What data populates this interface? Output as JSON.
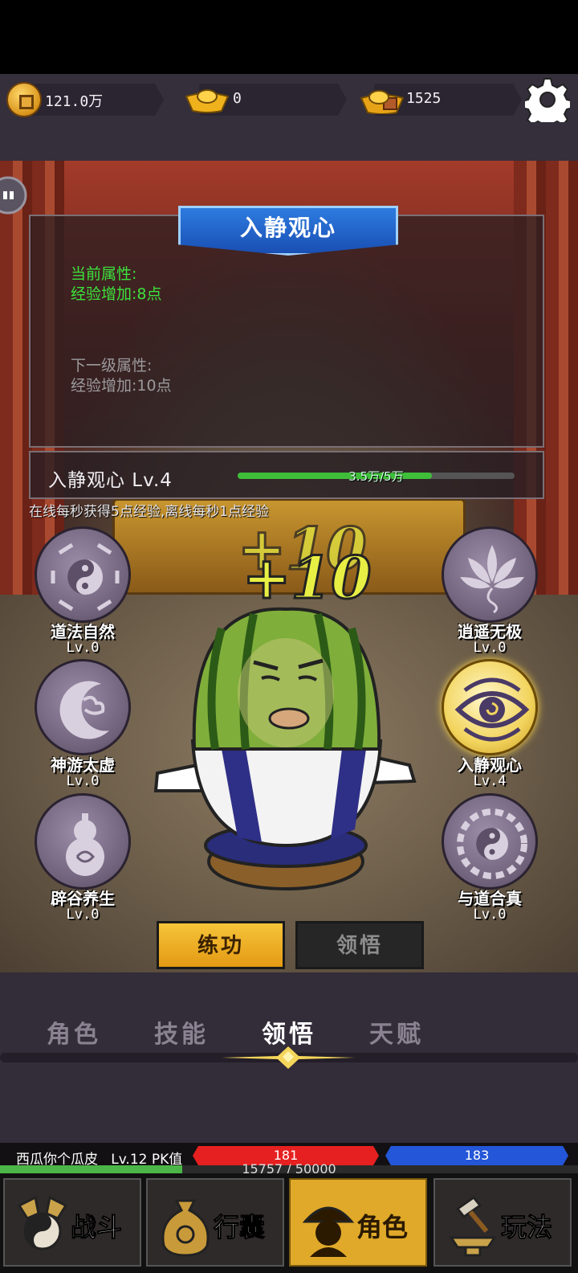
{
  "resources": {
    "copper": "121.0万",
    "gold_ingot": "0",
    "silver_ingot": "1525"
  },
  "panel": {
    "title": "入静观心",
    "current_label": "当前属性:",
    "current_value": "经验增加:8点",
    "next_label": "下一级属性:",
    "next_value": "经验增加:10点"
  },
  "level": {
    "name": "入静观心 Lv.4",
    "progress_text": "3.5万/5万",
    "progress_fraction": 0.7
  },
  "online_note": "在线每秒获得5点经验,离线每秒1点经验",
  "float_text": "+10",
  "skills": [
    {
      "name": "道法自然",
      "level": "Lv.0"
    },
    {
      "name": "神游太虚",
      "level": "Lv.0"
    },
    {
      "name": "辟谷养生",
      "level": "Lv.0"
    },
    {
      "name": "逍遥无极",
      "level": "Lv.0"
    },
    {
      "name": "入静观心",
      "level": "Lv.4"
    },
    {
      "name": "与道合真",
      "level": "Lv.0"
    }
  ],
  "mode_buttons": {
    "practice": "练功",
    "comprehend": "领悟"
  },
  "tabs": [
    "角色",
    "技能",
    "领悟",
    "天赋"
  ],
  "active_tab": "领悟",
  "player": {
    "name": "西瓜你个瓜皮",
    "level": "Lv.12",
    "pk_label": "PK值",
    "hp": "181",
    "mp": "183",
    "exp": "15757 / 50000",
    "exp_fraction": 0.315
  },
  "nav": [
    "战斗",
    "行囊",
    "角色",
    "玩法"
  ],
  "active_nav": "角色",
  "colors": {
    "accent_gold": "#e39a13",
    "attr_green": "#3ce23c",
    "hp_red": "#e62020",
    "mp_blue": "#2356d8",
    "banner_blue": "#2d7be0"
  }
}
